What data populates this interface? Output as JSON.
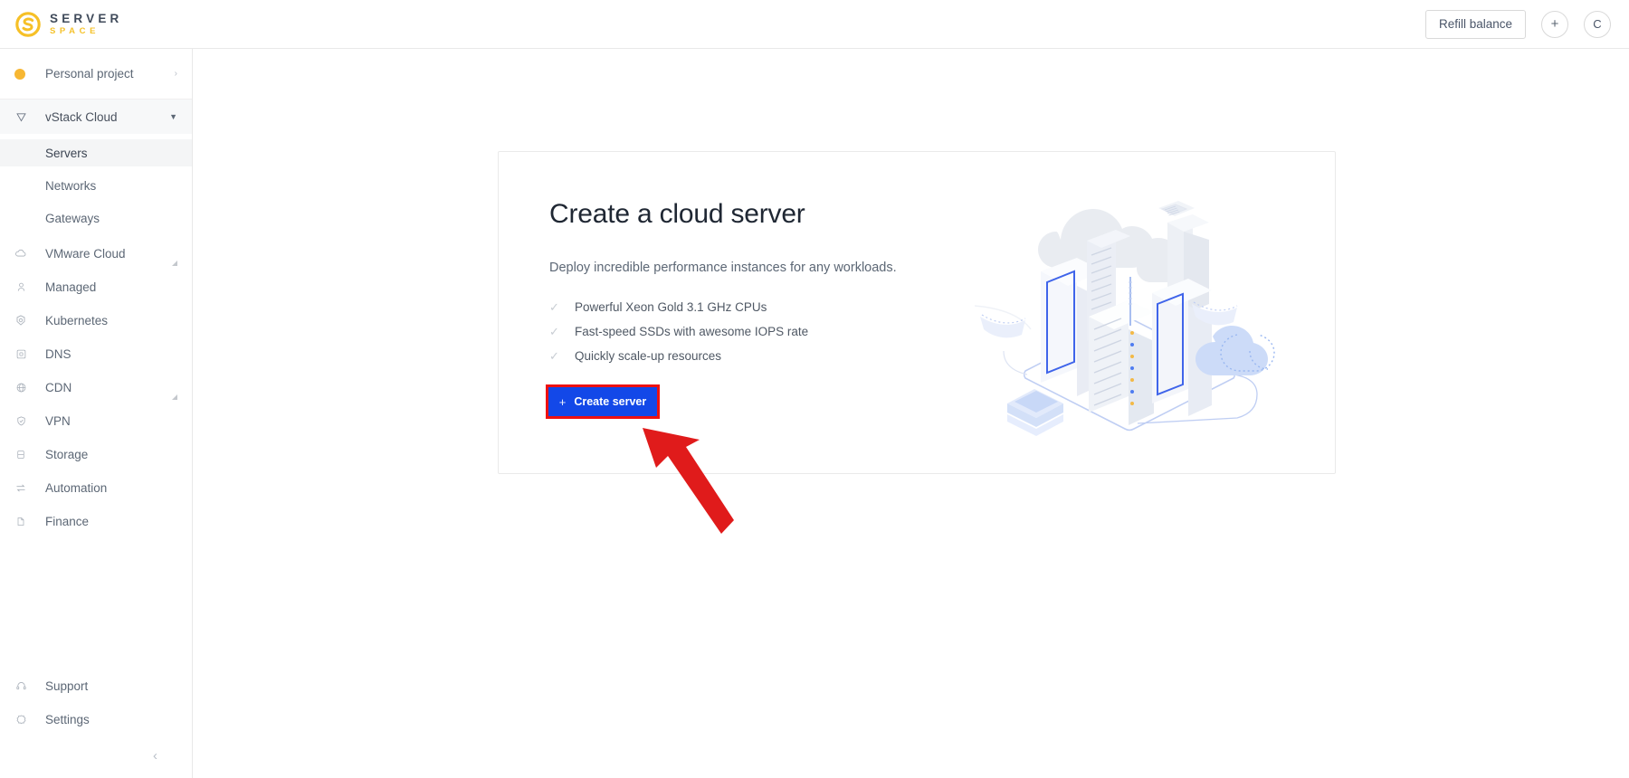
{
  "header": {
    "logo": {
      "icon": "serverspace-s-logo-icon",
      "line1": "SERVER",
      "line2": "SPACE"
    },
    "refill_label": "Refill balance",
    "add_label": "+",
    "avatar_label": "C"
  },
  "sidebar": {
    "project": {
      "label": "Personal project",
      "arrow": "›",
      "dot_color": "#f7b733"
    },
    "group": {
      "label": "vStack Cloud",
      "icon": "vstack-icon",
      "caret": "▼"
    },
    "items": [
      {
        "label": "Servers",
        "icon": "",
        "sub": true,
        "active": true,
        "expand": false
      },
      {
        "label": "Networks",
        "icon": "",
        "sub": true,
        "active": false,
        "expand": false
      },
      {
        "label": "Gateways",
        "icon": "",
        "sub": true,
        "active": false,
        "expand": false
      },
      {
        "label": "VMware Cloud",
        "icon": "cloud-icon",
        "sub": false,
        "active": false,
        "expand": true
      },
      {
        "label": "Managed",
        "icon": "managed-icon",
        "sub": false,
        "active": false,
        "expand": false
      },
      {
        "label": "Kubernetes",
        "icon": "kubernetes-icon",
        "sub": false,
        "active": false,
        "expand": false
      },
      {
        "label": "DNS",
        "icon": "dns-icon",
        "sub": false,
        "active": false,
        "expand": false
      },
      {
        "label": "CDN",
        "icon": "globe-icon",
        "sub": false,
        "active": false,
        "expand": true
      },
      {
        "label": "VPN",
        "icon": "shield-check-icon",
        "sub": false,
        "active": false,
        "expand": false
      },
      {
        "label": "Storage",
        "icon": "database-icon",
        "sub": false,
        "active": false,
        "expand": false
      },
      {
        "label": "Automation",
        "icon": "automation-icon",
        "sub": false,
        "active": false,
        "expand": false
      },
      {
        "label": "Finance",
        "icon": "document-icon",
        "sub": false,
        "active": false,
        "expand": false
      }
    ],
    "bottom_items": [
      {
        "label": "Support",
        "icon": "headset-icon"
      },
      {
        "label": "Settings",
        "icon": "settings-gear-icon"
      }
    ],
    "collapse": "‹"
  },
  "main": {
    "card": {
      "title": "Create a cloud server",
      "subtitle": "Deploy incredible performance instances for any workloads.",
      "features": [
        "Powerful Xeon Gold 3.1 GHz CPUs",
        "Fast-speed SSDs with awesome IOPS rate",
        "Quickly scale-up resources"
      ],
      "check_glyph": "✓",
      "cta": {
        "plus": "+",
        "label": "Create server",
        "color": "#1348e8",
        "highlight_color": "#ee1111"
      },
      "illustration": "isometric-datacenter-illustration"
    },
    "annotation": {
      "arrow": "red-pointer-arrow",
      "color": "#e01b1b"
    }
  }
}
